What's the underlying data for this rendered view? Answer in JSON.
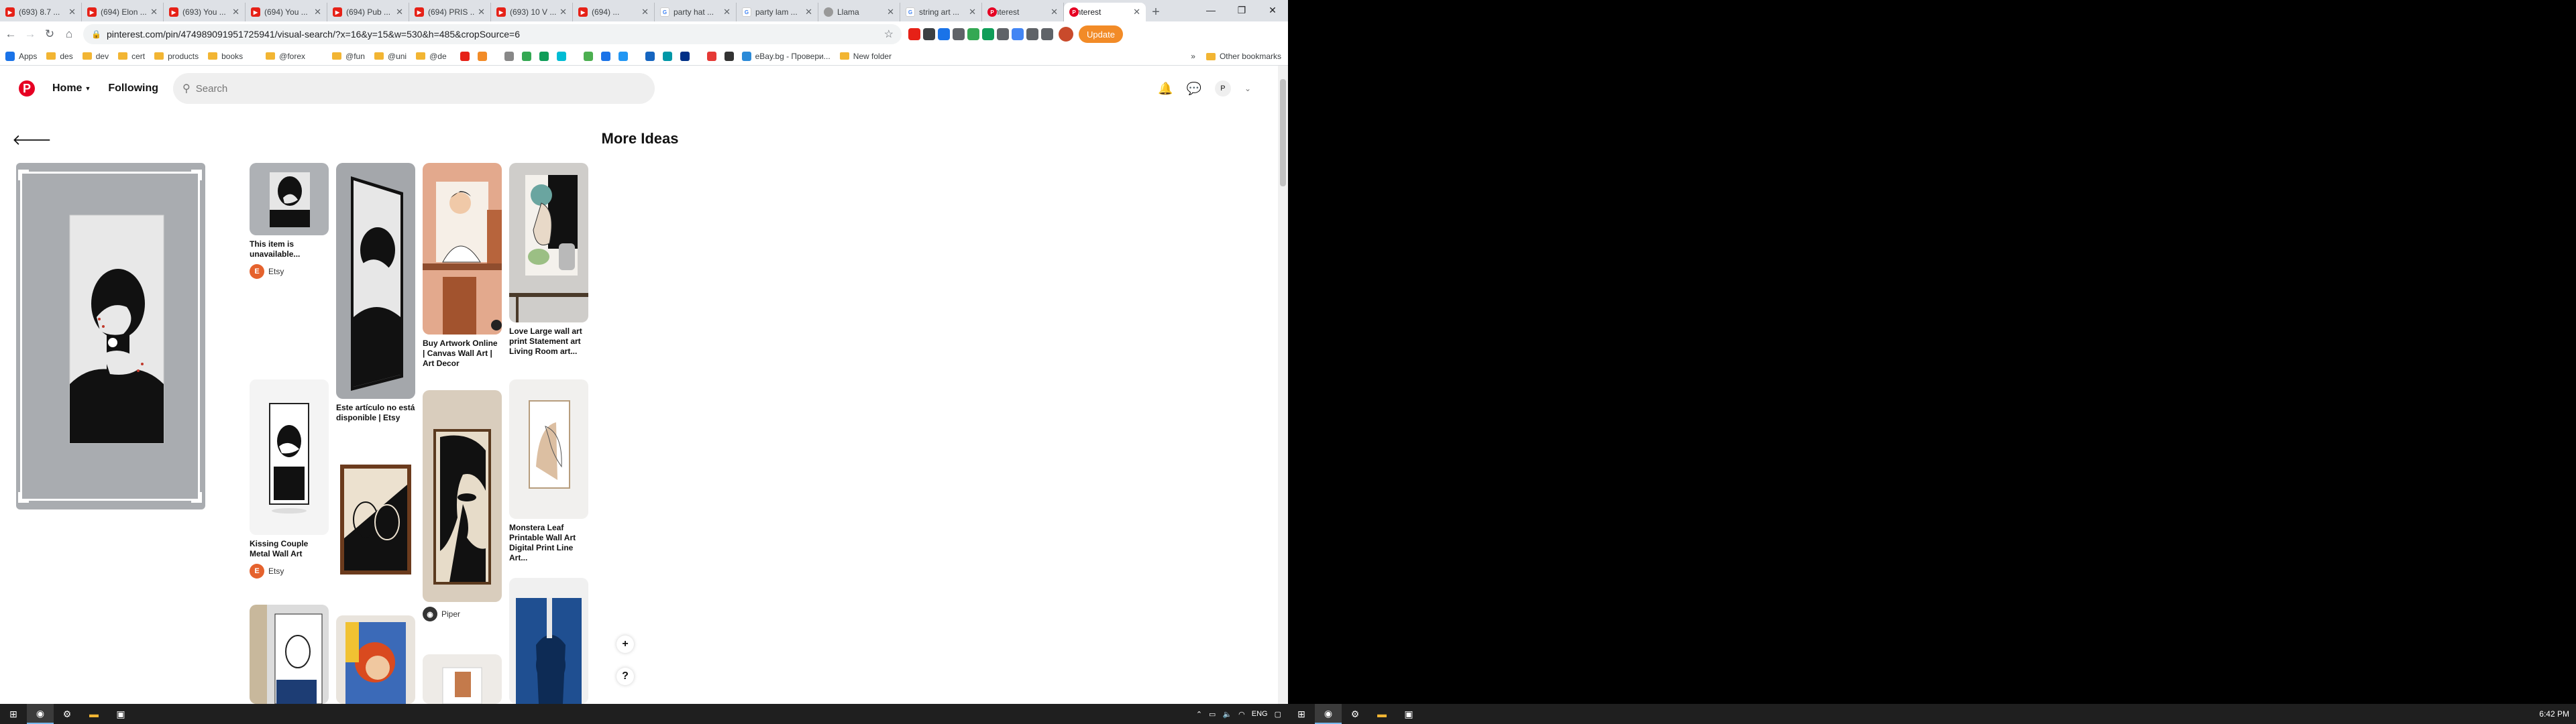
{
  "browser": {
    "tabs": [
      {
        "label": "(693) 8.7 ...",
        "icon": "youtube-icon"
      },
      {
        "label": "(694) Elon ...",
        "icon": "youtube-icon"
      },
      {
        "label": "(693) You ...",
        "icon": "youtube-icon"
      },
      {
        "label": "(694) You ...",
        "icon": "youtube-icon"
      },
      {
        "label": "(694) Pub ...",
        "icon": "youtube-icon"
      },
      {
        "label": "(694) PRIS ...",
        "icon": "youtube-icon"
      },
      {
        "label": "(693) 10 V ...",
        "icon": "youtube-icon"
      },
      {
        "label": "(694) ...",
        "icon": "youtube-icon"
      },
      {
        "label": "party hat ...",
        "icon": "google-icon"
      },
      {
        "label": "party lam ...",
        "icon": "google-icon"
      },
      {
        "label": "Llama",
        "icon": "llama-icon"
      },
      {
        "label": "string art ...",
        "icon": "google-icon"
      },
      {
        "label": "Pinterest",
        "icon": "pinterest-icon"
      },
      {
        "label": "Pinterest",
        "icon": "pinterest-icon",
        "active": true
      }
    ],
    "url": "pinterest.com/pin/474989091951725941/visual-search/?x=16&y=15&w=530&h=485&cropSource=6",
    "update_label": "Update",
    "bookmarks": [
      "Apps",
      "des",
      "dev",
      "cert",
      "products",
      "books",
      "@forex",
      "@fun",
      "@uni",
      "@de",
      "eBay.bg - Провери...",
      "New folder"
    ],
    "other_bookmarks": "Other bookmarks"
  },
  "pinterest": {
    "logo": "P",
    "nav_home": "Home",
    "nav_following": "Following",
    "search_placeholder": "Search",
    "avatar_letter": "P",
    "section_title": "More Ideas",
    "pins": [
      {
        "title": "This item is unavailable...",
        "source": "Etsy",
        "source_letter": "E"
      },
      {
        "title": "Kissing Couple Metal Wall Art",
        "source": "Etsy",
        "source_letter": "E"
      },
      {
        "title": "Este artículo no está disponible | Etsy"
      },
      {
        "title": "Buy Artwork Online | Canvas Wall Art | Art Decor"
      },
      {
        "source": "Piper"
      },
      {
        "title": "Love Large wall art print Statement art Living Room art..."
      },
      {
        "title": "Monstera Leaf Printable Wall Art Digital Print Line Art..."
      }
    ],
    "fab_plus": "+",
    "fab_help": "?"
  },
  "taskbar": {
    "language": "ENG",
    "time": "6:42 PM",
    "time_second": "6:42 PM"
  },
  "colors": {
    "pinterest_red": "#e60023",
    "update_orange": "#f28b27"
  }
}
